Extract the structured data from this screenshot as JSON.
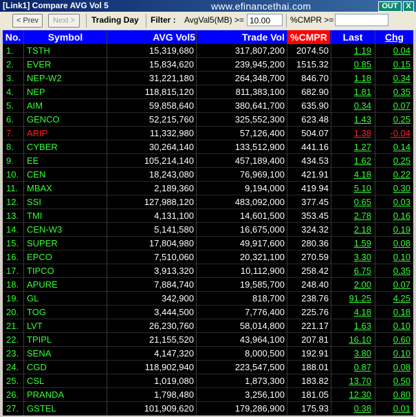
{
  "window": {
    "title": "[Link1] Compare AVG Vol 5",
    "watermark": "www.efinancethai.com",
    "out_label": "OUT",
    "close_label": "X"
  },
  "toolbar": {
    "prev_label": "< Prev",
    "next_label": "Next >",
    "trading_day_label": "Trading Day",
    "filter_label": "Filter :",
    "avgvol_field_label": "AvgVal5(MB) >=",
    "avgvol_value": "10.00",
    "cmpr_field_label": "%CMPR >=",
    "cmpr_value": ""
  },
  "table": {
    "headers": [
      "No.",
      "Symbol",
      "AVG Vol5",
      "Trade Vol",
      "%CMPR",
      "Last",
      "Chg"
    ],
    "rows": [
      {
        "no": "1.",
        "symbol": "TSTH",
        "avg": "15,319,680",
        "trade": "317,807,200",
        "cmpr": "2074.50",
        "last": "1.19",
        "chg": "0.04",
        "down": false
      },
      {
        "no": "2.",
        "symbol": "EVER",
        "avg": "15,834,620",
        "trade": "239,945,200",
        "cmpr": "1515.32",
        "last": "0.85",
        "chg": "0.15",
        "down": false
      },
      {
        "no": "3.",
        "symbol": "NEP-W2",
        "avg": "31,221,180",
        "trade": "264,348,700",
        "cmpr": "846.70",
        "last": "1.18",
        "chg": "0.34",
        "down": false
      },
      {
        "no": "4.",
        "symbol": "NEP",
        "avg": "118,815,120",
        "trade": "811,383,100",
        "cmpr": "682.90",
        "last": "1.81",
        "chg": "0.35",
        "down": false
      },
      {
        "no": "5.",
        "symbol": "AIM",
        "avg": "59,858,640",
        "trade": "380,641,700",
        "cmpr": "635.90",
        "last": "0.34",
        "chg": "0.07",
        "down": false
      },
      {
        "no": "6.",
        "symbol": "GENCO",
        "avg": "52,215,760",
        "trade": "325,552,300",
        "cmpr": "623.48",
        "last": "1.43",
        "chg": "0.25",
        "down": false
      },
      {
        "no": "7.",
        "symbol": "ARIP",
        "avg": "11,332,980",
        "trade": "57,126,400",
        "cmpr": "504.07",
        "last": "1.38",
        "chg": "-0.04",
        "down": true
      },
      {
        "no": "8.",
        "symbol": "CYBER",
        "avg": "30,264,140",
        "trade": "133,512,900",
        "cmpr": "441.16",
        "last": "1.27",
        "chg": "0.14",
        "down": false
      },
      {
        "no": "9.",
        "symbol": "EE",
        "avg": "105,214,140",
        "trade": "457,189,400",
        "cmpr": "434.53",
        "last": "1.62",
        "chg": "0.25",
        "down": false
      },
      {
        "no": "10.",
        "symbol": "CEN",
        "avg": "18,243,080",
        "trade": "76,969,100",
        "cmpr": "421.91",
        "last": "4.18",
        "chg": "0.22",
        "down": false
      },
      {
        "no": "11.",
        "symbol": "MBAX",
        "avg": "2,189,360",
        "trade": "9,194,000",
        "cmpr": "419.94",
        "last": "5.10",
        "chg": "0.30",
        "down": false
      },
      {
        "no": "12.",
        "symbol": "SSI",
        "avg": "127,988,120",
        "trade": "483,092,000",
        "cmpr": "377.45",
        "last": "0.65",
        "chg": "0.03",
        "down": false
      },
      {
        "no": "13.",
        "symbol": "TMI",
        "avg": "4,131,100",
        "trade": "14,601,500",
        "cmpr": "353.45",
        "last": "2.78",
        "chg": "0.16",
        "down": false
      },
      {
        "no": "14.",
        "symbol": "CEN-W3",
        "avg": "5,141,580",
        "trade": "16,675,000",
        "cmpr": "324.32",
        "last": "2.18",
        "chg": "0.19",
        "down": false
      },
      {
        "no": "15.",
        "symbol": "SUPER",
        "avg": "17,804,980",
        "trade": "49,917,600",
        "cmpr": "280.36",
        "last": "1.59",
        "chg": "0.08",
        "down": false
      },
      {
        "no": "16.",
        "symbol": "EPCO",
        "avg": "7,510,060",
        "trade": "20,321,100",
        "cmpr": "270.59",
        "last": "3.30",
        "chg": "0.10",
        "down": false
      },
      {
        "no": "17.",
        "symbol": "TIPCO",
        "avg": "3,913,320",
        "trade": "10,112,900",
        "cmpr": "258.42",
        "last": "6.75",
        "chg": "0.35",
        "down": false
      },
      {
        "no": "18.",
        "symbol": "APURE",
        "avg": "7,884,740",
        "trade": "19,585,700",
        "cmpr": "248.40",
        "last": "2.00",
        "chg": "0.07",
        "down": false
      },
      {
        "no": "19.",
        "symbol": "GL",
        "avg": "342,900",
        "trade": "818,700",
        "cmpr": "238.76",
        "last": "91.25",
        "chg": "4.25",
        "down": false
      },
      {
        "no": "20.",
        "symbol": "TOG",
        "avg": "3,444,500",
        "trade": "7,776,400",
        "cmpr": "225.76",
        "last": "4.18",
        "chg": "0.18",
        "down": false
      },
      {
        "no": "21.",
        "symbol": "LVT",
        "avg": "26,230,760",
        "trade": "58,014,800",
        "cmpr": "221.17",
        "last": "1.63",
        "chg": "0.10",
        "down": false
      },
      {
        "no": "22.",
        "symbol": "TPIPL",
        "avg": "21,155,520",
        "trade": "43,964,100",
        "cmpr": "207.81",
        "last": "16.10",
        "chg": "0.60",
        "down": false
      },
      {
        "no": "23.",
        "symbol": "SENA",
        "avg": "4,147,320",
        "trade": "8,000,500",
        "cmpr": "192.91",
        "last": "3.80",
        "chg": "0.10",
        "down": false
      },
      {
        "no": "24.",
        "symbol": "CGD",
        "avg": "118,902,940",
        "trade": "223,547,500",
        "cmpr": "188.01",
        "last": "0.87",
        "chg": "0.08",
        "down": false
      },
      {
        "no": "25.",
        "symbol": "CSL",
        "avg": "1,019,080",
        "trade": "1,873,300",
        "cmpr": "183.82",
        "last": "13.70",
        "chg": "0.50",
        "down": false
      },
      {
        "no": "26.",
        "symbol": "PRANDA",
        "avg": "1,798,480",
        "trade": "3,256,100",
        "cmpr": "181.05",
        "last": "12.30",
        "chg": "0.80",
        "down": false
      },
      {
        "no": "27.",
        "symbol": "GSTEL",
        "avg": "101,909,620",
        "trade": "179,286,900",
        "cmpr": "175.93",
        "last": "0.38",
        "chg": "0.01",
        "down": false
      }
    ]
  }
}
